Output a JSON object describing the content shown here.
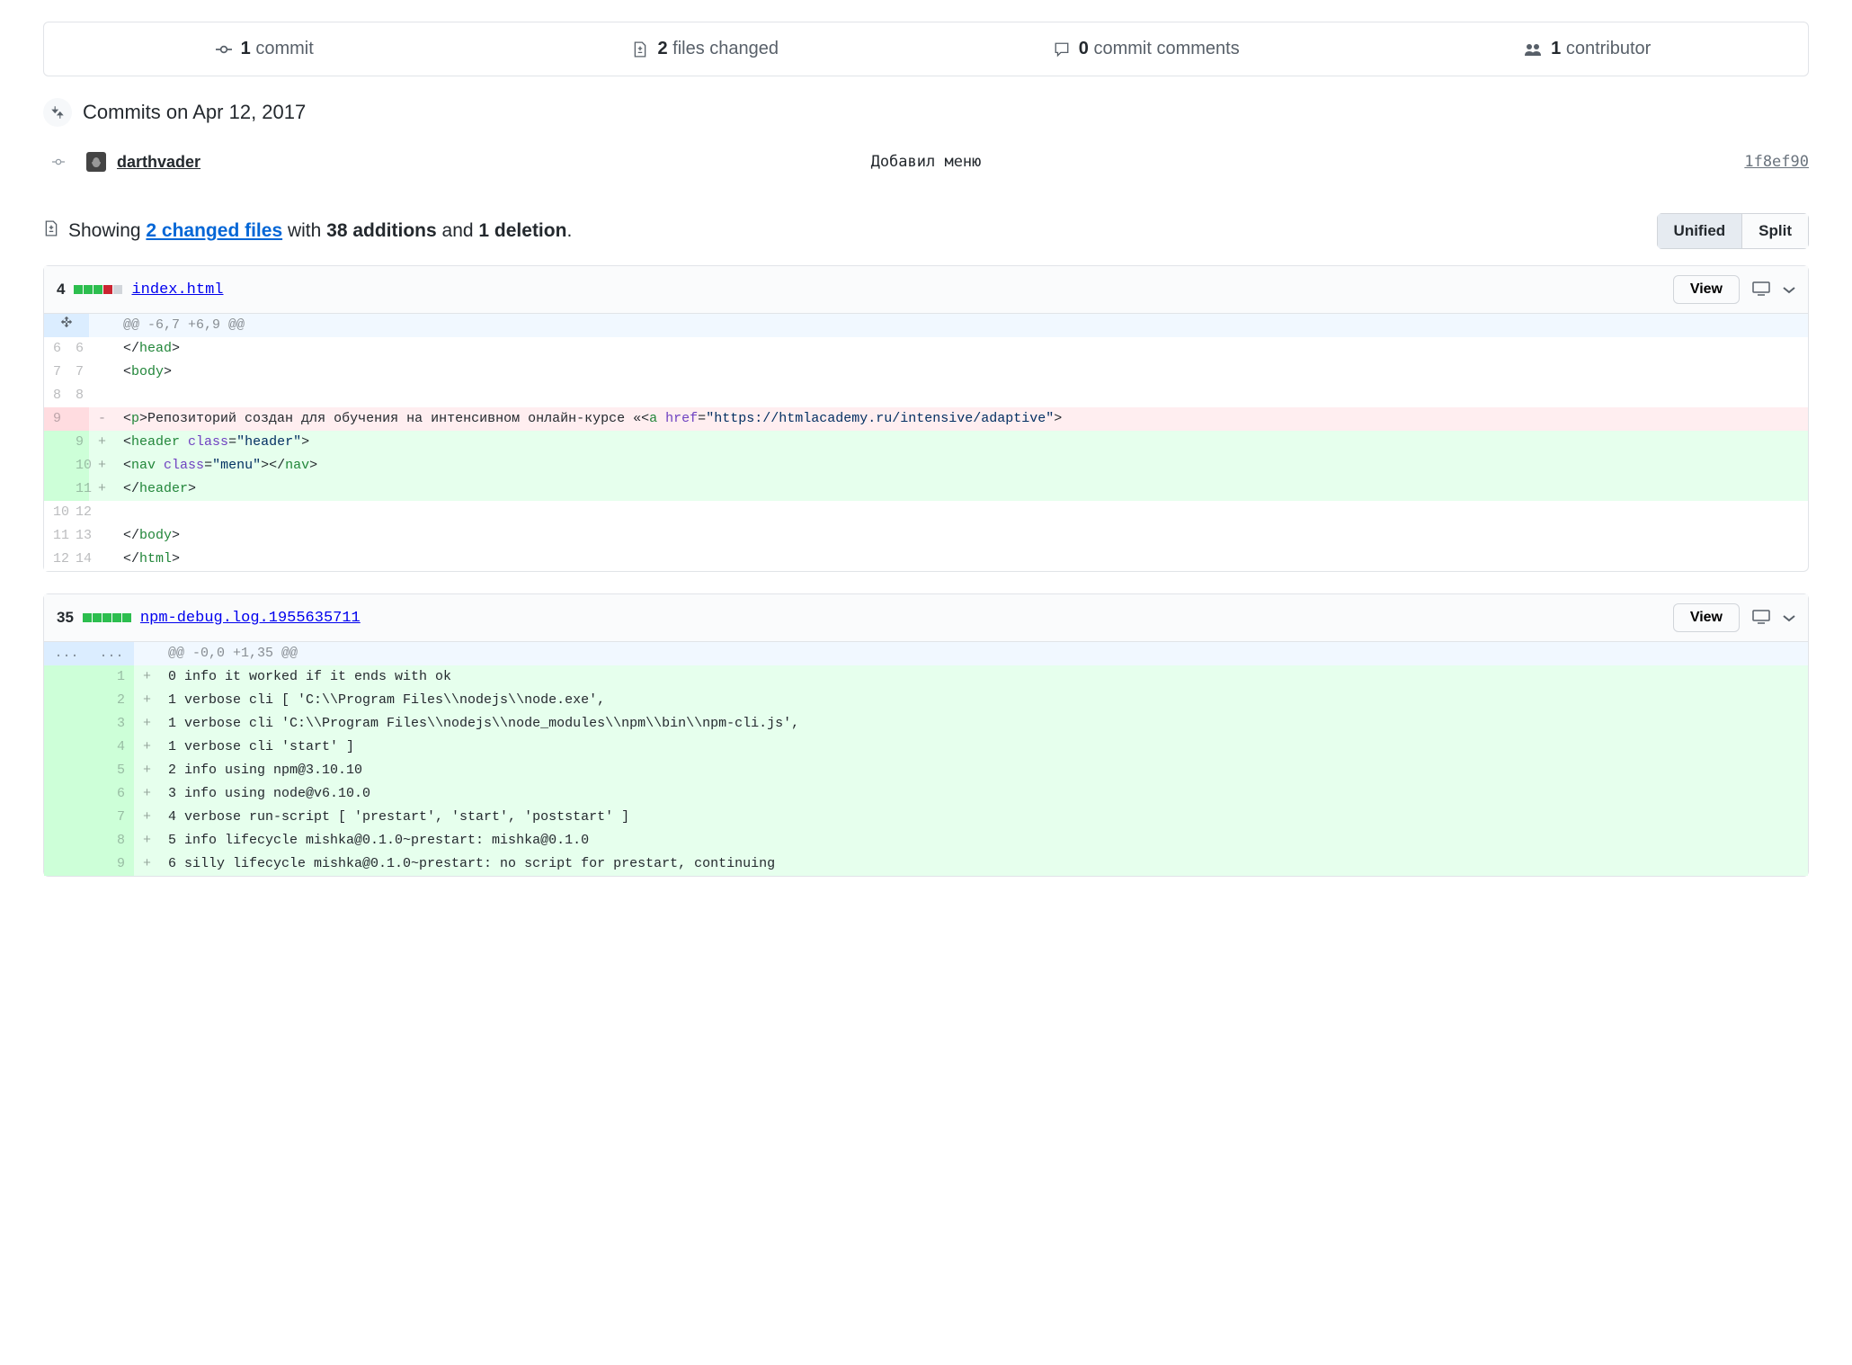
{
  "stats": {
    "commits": {
      "count": "1",
      "label": "commit"
    },
    "files": {
      "count": "2",
      "label": "files changed"
    },
    "comments": {
      "count": "0",
      "label": "commit comments"
    },
    "contributors": {
      "count": "1",
      "label": "contributor"
    }
  },
  "commits_date_label": "Commits on Apr 12, 2017",
  "commit": {
    "author": "darthvader",
    "message": "Добавил меню",
    "sha": "1f8ef90"
  },
  "diffbar": {
    "showing": "Showing",
    "changed_files": "2 changed files",
    "with": " with ",
    "additions": "38 additions",
    "and": " and ",
    "deletions": "1 deletion",
    "period": ".",
    "unified": "Unified",
    "split": "Split"
  },
  "files": [
    {
      "changes": "4",
      "diffstat": [
        "add",
        "add",
        "add",
        "del",
        "neutral"
      ],
      "name": "index.html",
      "view": "View",
      "hunk_header": "@@ -6,7 +6,9 @@",
      "rows": [
        {
          "type": "ctx",
          "l": "6",
          "r": "6",
          "sign": "",
          "text": "  </head>",
          "tokens": [
            [
              "  </",
              ""
            ],
            [
              "head",
              "pl-ent"
            ],
            [
              ">",
              ""
            ]
          ]
        },
        {
          "type": "ctx",
          "l": "7",
          "r": "7",
          "sign": "",
          "text": "  <body>",
          "tokens": [
            [
              "  <",
              ""
            ],
            [
              "body",
              "pl-ent"
            ],
            [
              ">",
              ""
            ]
          ]
        },
        {
          "type": "ctx",
          "l": "8",
          "r": "8",
          "sign": "",
          "text": "",
          "tokens": []
        },
        {
          "type": "del",
          "l": "9",
          "r": "",
          "sign": "-",
          "text": "    <p>Репозиторий создан для обучения на интенсивном онлайн-курсе «<a href=\"https://htmlacademy.ru/intensive/adaptive\">",
          "tokens": [
            [
              "    <",
              ""
            ],
            [
              "p",
              "pl-ent"
            ],
            [
              ">Репозиторий создан для обучения на интенсивном онлайн-курсе «<",
              ""
            ],
            [
              "a",
              "pl-ent"
            ],
            [
              " ",
              ""
            ],
            [
              "href",
              "pl-e"
            ],
            [
              "=",
              ""
            ],
            [
              "\"https://htmlacademy.ru/intensive/adaptive\"",
              "pl-s"
            ],
            [
              ">",
              ""
            ]
          ]
        },
        {
          "type": "add",
          "l": "",
          "r": "9",
          "sign": "+",
          "text": "    <header class=\"header\">",
          "tokens": [
            [
              "    <",
              ""
            ],
            [
              "header",
              "pl-ent"
            ],
            [
              " ",
              ""
            ],
            [
              "class",
              "pl-e"
            ],
            [
              "=",
              ""
            ],
            [
              "\"header\"",
              "pl-s"
            ],
            [
              ">",
              ""
            ]
          ]
        },
        {
          "type": "add",
          "l": "",
          "r": "10",
          "sign": "+",
          "text": "        <nav class=\"menu\"></nav>",
          "tokens": [
            [
              "        <",
              ""
            ],
            [
              "nav",
              "pl-ent"
            ],
            [
              " ",
              ""
            ],
            [
              "class",
              "pl-e"
            ],
            [
              "=",
              ""
            ],
            [
              "\"menu\"",
              "pl-s"
            ],
            [
              "></",
              ""
            ],
            [
              "nav",
              "pl-ent"
            ],
            [
              ">",
              ""
            ]
          ]
        },
        {
          "type": "add",
          "l": "",
          "r": "11",
          "sign": "+",
          "text": "    </header>",
          "tokens": [
            [
              "    </",
              ""
            ],
            [
              "header",
              "pl-ent"
            ],
            [
              ">",
              ""
            ]
          ]
        },
        {
          "type": "ctx",
          "l": "10",
          "r": "12",
          "sign": "",
          "text": "",
          "tokens": []
        },
        {
          "type": "ctx",
          "l": "11",
          "r": "13",
          "sign": "",
          "text": "  </body>",
          "tokens": [
            [
              "  </",
              ""
            ],
            [
              "body",
              "pl-ent"
            ],
            [
              ">",
              ""
            ]
          ]
        },
        {
          "type": "ctx",
          "l": "12",
          "r": "14",
          "sign": "",
          "text": "</html>",
          "tokens": [
            [
              "</",
              ""
            ],
            [
              "html",
              "pl-ent"
            ],
            [
              ">",
              ""
            ]
          ]
        }
      ]
    },
    {
      "changes": "35",
      "diffstat": [
        "add",
        "add",
        "add",
        "add",
        "add"
      ],
      "name": "npm-debug.log.1955635711",
      "view": "View",
      "hunk_header": "@@ -0,0 +1,35 @@",
      "rows": [
        {
          "type": "add",
          "l": "",
          "r": "1",
          "sign": "+",
          "text": "0 info it worked if it ends with ok",
          "tokens": [
            [
              "0 info it worked if it ends with ok",
              ""
            ]
          ]
        },
        {
          "type": "add",
          "l": "",
          "r": "2",
          "sign": "+",
          "text": "1 verbose cli [ 'C:\\\\Program Files\\\\nodejs\\\\node.exe',",
          "tokens": [
            [
              "1 verbose cli [ 'C:\\\\Program Files\\\\nodejs\\\\node.exe',",
              ""
            ]
          ]
        },
        {
          "type": "add",
          "l": "",
          "r": "3",
          "sign": "+",
          "text": "1 verbose cli   'C:\\\\Program Files\\\\nodejs\\\\node_modules\\\\npm\\\\bin\\\\npm-cli.js',",
          "tokens": [
            [
              "1 verbose cli   'C:\\\\Program Files\\\\nodejs\\\\node_modules\\\\npm\\\\bin\\\\npm-cli.js',",
              ""
            ]
          ]
        },
        {
          "type": "add",
          "l": "",
          "r": "4",
          "sign": "+",
          "text": "1 verbose cli   'start' ]",
          "tokens": [
            [
              "1 verbose cli   'start' ]",
              ""
            ]
          ]
        },
        {
          "type": "add",
          "l": "",
          "r": "5",
          "sign": "+",
          "text": "2 info using npm@3.10.10",
          "tokens": [
            [
              "2 info using npm@3.10.10",
              ""
            ]
          ]
        },
        {
          "type": "add",
          "l": "",
          "r": "6",
          "sign": "+",
          "text": "3 info using node@v6.10.0",
          "tokens": [
            [
              "3 info using node@v6.10.0",
              ""
            ]
          ]
        },
        {
          "type": "add",
          "l": "",
          "r": "7",
          "sign": "+",
          "text": "4 verbose run-script [ 'prestart', 'start', 'poststart' ]",
          "tokens": [
            [
              "4 verbose run-script [ 'prestart', 'start', 'poststart' ]",
              ""
            ]
          ]
        },
        {
          "type": "add",
          "l": "",
          "r": "8",
          "sign": "+",
          "text": "5 info lifecycle mishka@0.1.0~prestart: mishka@0.1.0",
          "tokens": [
            [
              "5 info lifecycle mishka@0.1.0~prestart: mishka@0.1.0",
              ""
            ]
          ]
        },
        {
          "type": "add",
          "l": "",
          "r": "9",
          "sign": "+",
          "text": "6 silly lifecycle mishka@0.1.0~prestart: no script for prestart, continuing",
          "tokens": [
            [
              "6 silly lifecycle mishka@0.1.0~prestart: no script for prestart, continuing",
              ""
            ]
          ]
        }
      ]
    }
  ]
}
